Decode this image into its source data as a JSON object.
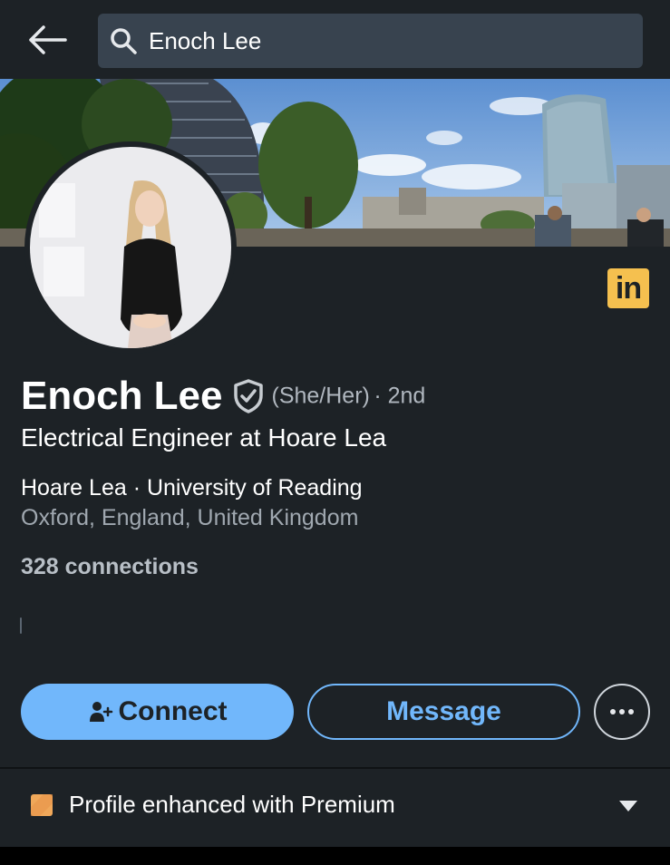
{
  "search": {
    "value": "Enoch Lee"
  },
  "profile": {
    "name": "Enoch Lee",
    "pronouns": "(She/Her)",
    "degree": "· 2nd",
    "headline": "Electrical Engineer at Hoare Lea",
    "company_line": "Hoare Lea · University of Reading",
    "location": "Oxford, England, United Kingdom",
    "connections": "328 connections"
  },
  "badge": {
    "linkedin_text": "in"
  },
  "actions": {
    "connect_label": "Connect",
    "message_label": "Message"
  },
  "premium": {
    "label": "Profile enhanced with Premium"
  },
  "colors": {
    "background": "#1d2226",
    "accent": "#71b7fb",
    "linkedin_badge": "#f5c04f",
    "premium_icon": "#f0a85a"
  },
  "icons": [
    "back-arrow-icon",
    "search-icon",
    "verified-shield-icon",
    "add-person-icon",
    "more-icon",
    "premium-icon",
    "chevron-down-icon"
  ]
}
